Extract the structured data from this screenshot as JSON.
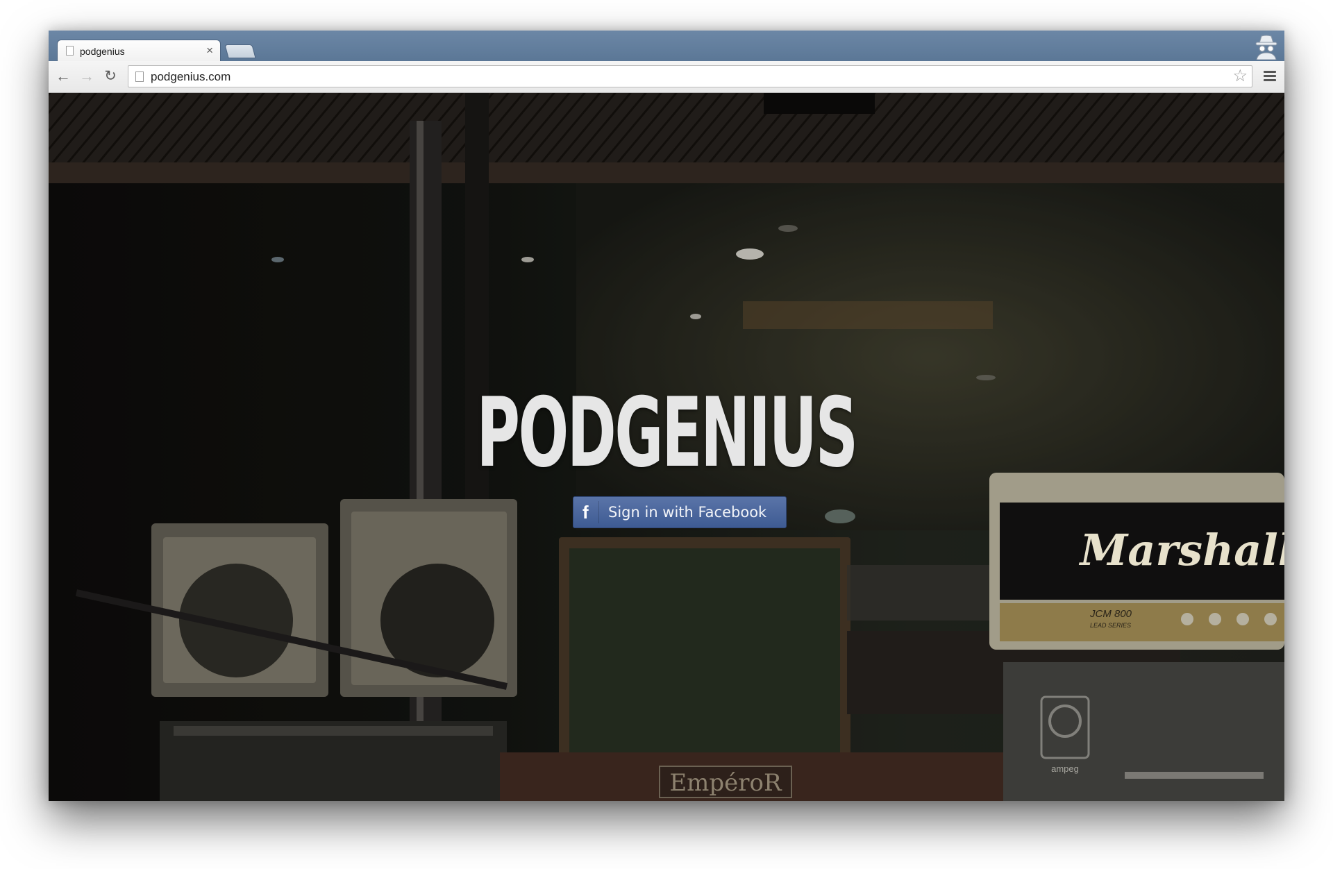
{
  "browser": {
    "tab": {
      "title": "podgenius",
      "close_glyph": "×"
    },
    "toolbar": {
      "back_icon": "back-arrow-icon",
      "forward_icon": "forward-arrow-icon",
      "reload_icon": "reload-icon",
      "url": "podgenius.com",
      "bookmark_icon": "star-icon",
      "menu_icon": "hamburger-menu-icon"
    },
    "profile_icon": "incognito-icon",
    "colors": {
      "tabstrip": "#6c87a6",
      "toolbar": "#eeeeee"
    }
  },
  "page": {
    "brand_title": "PODGENIUS",
    "signin_button": {
      "label": "Sign in with Facebook",
      "icon": "facebook-f-icon",
      "glyph": "f",
      "color": "#3e5b93"
    },
    "background_amp_logos": {
      "marshall": "Marshall",
      "marshall_model": "JCM 800",
      "marshall_series": "LEAD SERIES",
      "emperor": "EmpéroR",
      "ampeg": "ampeg"
    }
  }
}
